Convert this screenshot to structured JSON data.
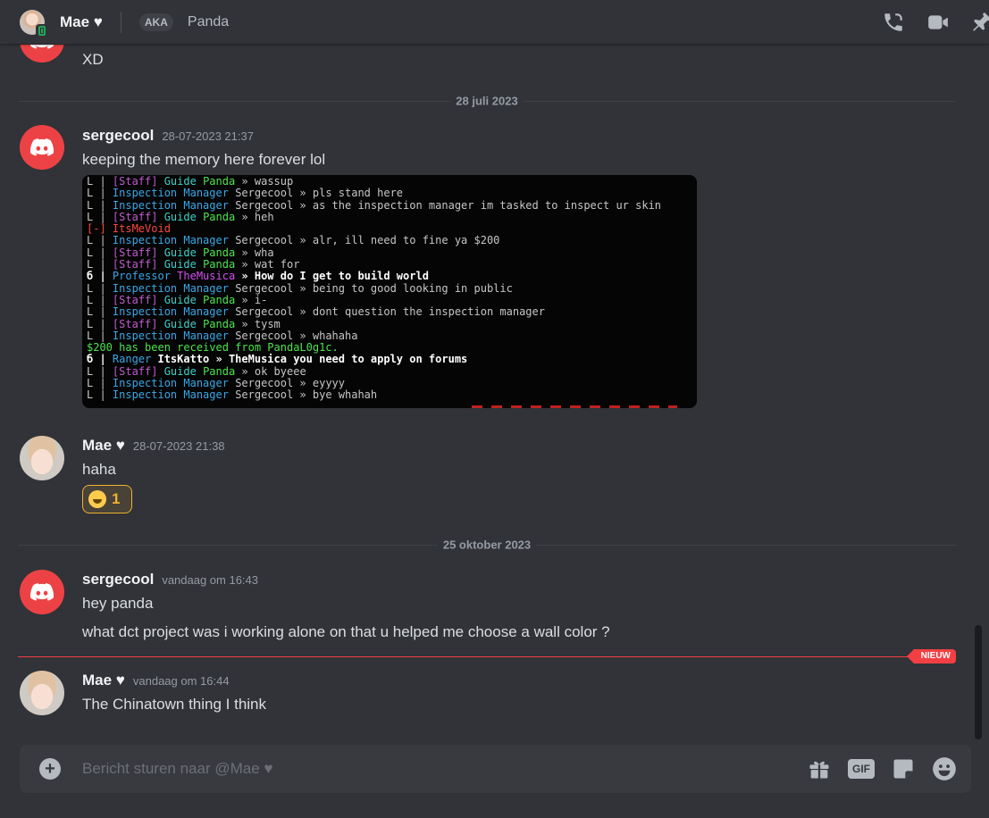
{
  "header": {
    "name": "Mae ♥",
    "aka": "AKA",
    "nickname": "Panda",
    "icons": [
      "phone-call-icon",
      "video-camera-icon",
      "pin-icon"
    ]
  },
  "messages": {
    "prev_text": "XD",
    "divider_1": "28 juli 2023",
    "m1": {
      "user": "sergecool",
      "time": "28-07-2023 21:37",
      "text": "keeping the memory here forever lol"
    },
    "m2": {
      "user": "Mae ♥",
      "time": "28-07-2023 21:38",
      "text": "haha",
      "reaction_count": "1"
    },
    "divider_2": "25 oktober 2023",
    "m3": {
      "user": "sergecool",
      "time": "vandaag om 16:43",
      "text1": "hey panda",
      "text2": "what dct project was i working alone on that u helped me choose a wall color ?"
    },
    "new_badge": "NIEUW",
    "m4": {
      "user": "Mae ♥",
      "time": "vandaag om 16:44",
      "text": "The Chinatown thing I think"
    }
  },
  "mc_chat": [
    [
      [
        "c-gray",
        "L | "
      ],
      [
        "c-staff",
        "[Staff] "
      ],
      [
        "c-guide",
        "Guide "
      ],
      [
        "c-green",
        "Panda "
      ],
      [
        "c-gray",
        "» wassup"
      ]
    ],
    [
      [
        "c-gray",
        "L | "
      ],
      [
        "c-aqua",
        "Inspection Manager "
      ],
      [
        "c-gray",
        "Sergecool » pls stand here"
      ]
    ],
    [
      [
        "c-gray",
        "L | "
      ],
      [
        "c-aqua",
        "Inspection Manager "
      ],
      [
        "c-gray",
        "Sergecool » as the inspection manager im tasked to inspect ur skin"
      ]
    ],
    [
      [
        "c-gray",
        "L | "
      ],
      [
        "c-staff",
        "[Staff] "
      ],
      [
        "c-guide",
        "Guide "
      ],
      [
        "c-green",
        "Panda "
      ],
      [
        "c-gray",
        "» heh"
      ]
    ],
    [
      [
        "c-red",
        "[-] ItsMeVoid"
      ]
    ],
    [
      [
        "c-gray",
        "L | "
      ],
      [
        "c-aqua",
        "Inspection Manager "
      ],
      [
        "c-gray",
        "Sergecool » alr, ill need to fine ya $200"
      ]
    ],
    [
      [
        "c-gray",
        "L | "
      ],
      [
        "c-staff",
        "[Staff] "
      ],
      [
        "c-guide",
        "Guide "
      ],
      [
        "c-green",
        "Panda "
      ],
      [
        "c-gray",
        "» wha"
      ]
    ],
    [
      [
        "c-gray",
        "L | "
      ],
      [
        "c-staff",
        "[Staff] "
      ],
      [
        "c-guide",
        "Guide "
      ],
      [
        "c-green",
        "Panda "
      ],
      [
        "c-gray",
        "» wat for"
      ]
    ],
    [
      [
        "c-white",
        "б | "
      ],
      [
        "c-aqua",
        "Professor "
      ],
      [
        "c-purple",
        "TheMusica "
      ],
      [
        "c-white",
        "» How do I get to build world"
      ]
    ],
    [
      [
        "c-gray",
        "L | "
      ],
      [
        "c-aqua",
        "Inspection Manager "
      ],
      [
        "c-gray",
        "Sergecool » being to good looking in public"
      ]
    ],
    [
      [
        "c-gray",
        "L | "
      ],
      [
        "c-staff",
        "[Staff] "
      ],
      [
        "c-guide",
        "Guide "
      ],
      [
        "c-green",
        "Panda "
      ],
      [
        "c-gray",
        "» i-"
      ]
    ],
    [
      [
        "c-gray",
        "L | "
      ],
      [
        "c-aqua",
        "Inspection Manager "
      ],
      [
        "c-gray",
        "Sergecool » dont question the inspection manager"
      ]
    ],
    [
      [
        "c-gray",
        "L | "
      ],
      [
        "c-staff",
        "[Staff] "
      ],
      [
        "c-guide",
        "Guide "
      ],
      [
        "c-green",
        "Panda "
      ],
      [
        "c-gray",
        "» tysm"
      ]
    ],
    [
      [
        "c-gray",
        "L | "
      ],
      [
        "c-aqua",
        "Inspection Manager "
      ],
      [
        "c-gray",
        "Sergecool » whahaha"
      ]
    ],
    [
      [
        "c-green",
        "$200 has been received from PandaL0g1c."
      ]
    ],
    [
      [
        "c-white",
        "б | "
      ],
      [
        "c-aqua",
        "Ranger "
      ],
      [
        "c-white",
        "ItsKatto » TheMusica you need to apply on forums"
      ]
    ],
    [
      [
        "c-gray",
        "L | "
      ],
      [
        "c-staff",
        "[Staff] "
      ],
      [
        "c-guide",
        "Guide "
      ],
      [
        "c-green",
        "Panda "
      ],
      [
        "c-gray",
        "» ok byeee"
      ]
    ],
    [
      [
        "c-gray",
        "L | "
      ],
      [
        "c-aqua",
        "Inspection Manager "
      ],
      [
        "c-gray",
        "Sergecool » eyyyy"
      ]
    ],
    [
      [
        "c-gray",
        "L | "
      ],
      [
        "c-aqua",
        "Inspection Manager "
      ],
      [
        "c-gray",
        "Sergecool » bye whahah"
      ]
    ]
  ],
  "composer": {
    "placeholder": "Bericht sturen naar @Mae ♥",
    "gif_label": "GIF",
    "icons": [
      "add-attachment-icon",
      "gift-icon",
      "gif-icon",
      "sticker-icon",
      "emoji-icon"
    ]
  }
}
